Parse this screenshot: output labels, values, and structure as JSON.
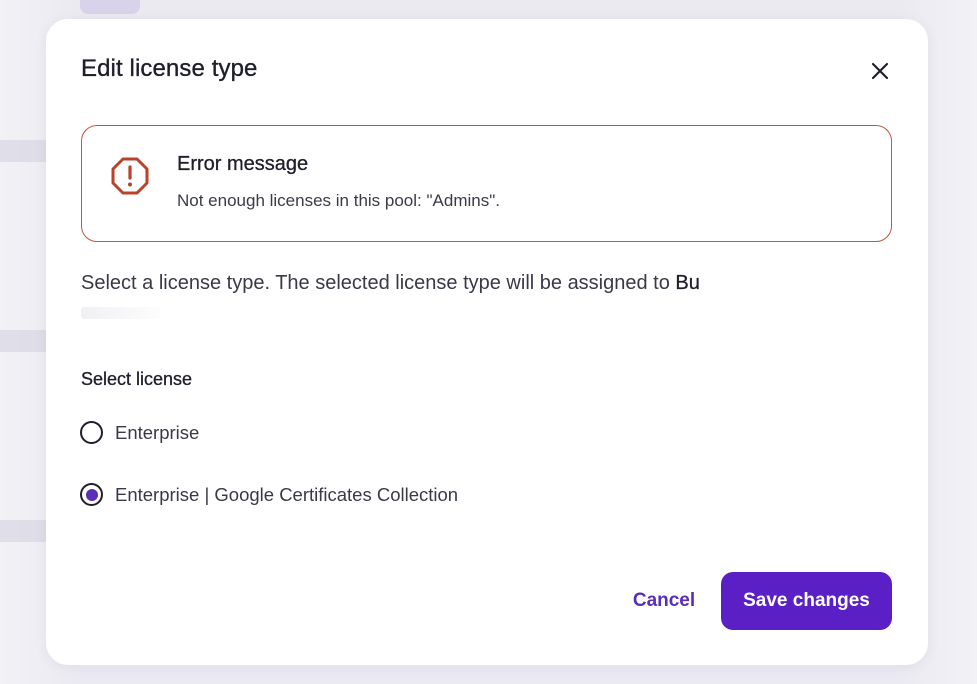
{
  "dialog": {
    "title": "Edit license type",
    "close_icon": "close-icon"
  },
  "error": {
    "icon": "error-octagon-icon",
    "title": "Error message",
    "text": "Not enough licenses in this pool: \"Admins\"."
  },
  "description": {
    "text": "Select a license type. The selected license type will be assigned to ",
    "name": "Bu"
  },
  "license": {
    "label": "Select license",
    "options": [
      {
        "label": "Enterprise",
        "checked": false
      },
      {
        "label": "Enterprise | Google Certificates Collection",
        "checked": true
      }
    ]
  },
  "actions": {
    "cancel_label": "Cancel",
    "save_label": "Save changes"
  },
  "colors": {
    "accent": "#5a1fc5",
    "error_border": "#c2553a",
    "error_icon": "#b8432a"
  }
}
